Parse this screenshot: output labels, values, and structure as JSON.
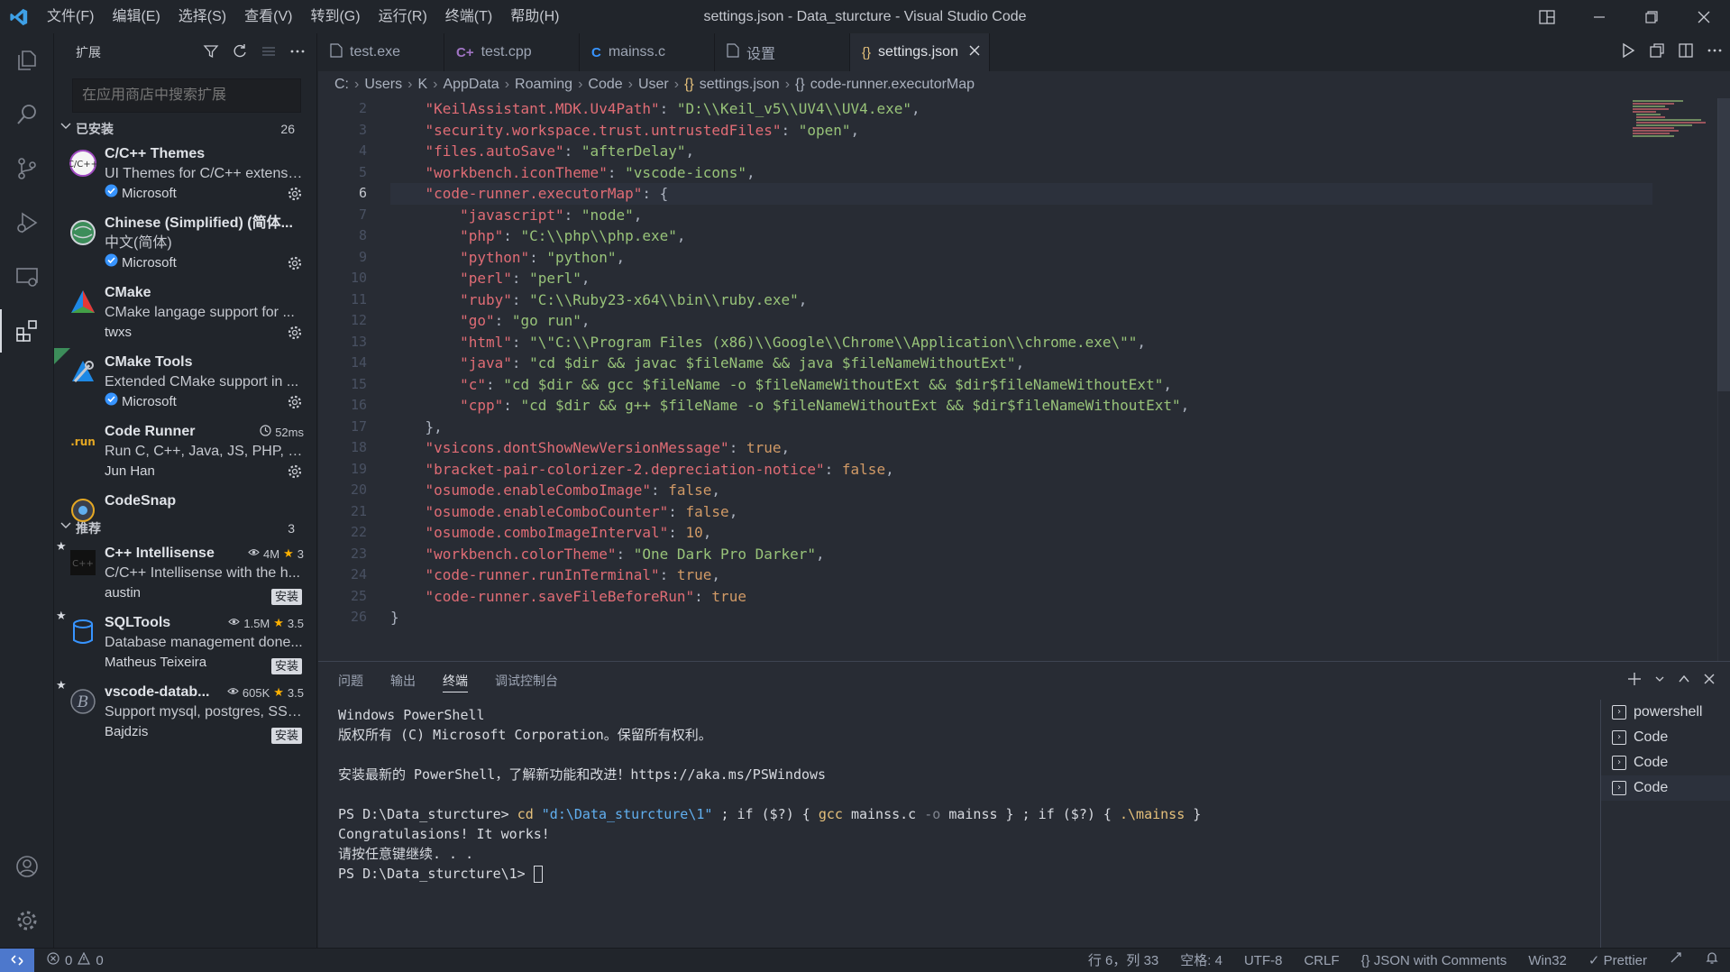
{
  "window": {
    "title": "settings.json - Data_sturcture - Visual Studio Code",
    "menu": [
      "文件(F)",
      "编辑(E)",
      "选择(S)",
      "查看(V)",
      "转到(G)",
      "运行(R)",
      "终端(T)",
      "帮助(H)"
    ]
  },
  "sidebar": {
    "title": "扩展",
    "search_placeholder": "在应用商店中搜索扩展",
    "installed": {
      "label": "已安装",
      "count": "26",
      "items": [
        {
          "name": "C/C++ Themes",
          "desc": "UI Themes for C/C++ extensi...",
          "publisher": "Microsoft",
          "icon": "cpp-themes-icon",
          "meta": ""
        },
        {
          "name": "Chinese (Simplified) (简体...",
          "desc": "中文(简体)",
          "publisher": "Microsoft",
          "icon": "globe-icon",
          "meta": ""
        },
        {
          "name": "CMake",
          "desc": "CMake langage support for ...",
          "publisher": "twxs",
          "icon": "cmake-icon",
          "meta": ""
        },
        {
          "name": "CMake Tools",
          "desc": "Extended CMake support in ...",
          "publisher": "Microsoft",
          "icon": "cmake-tools-icon",
          "meta": ""
        },
        {
          "name": "Code Runner",
          "desc": "Run C, C++, Java, JS, PHP, Py...",
          "publisher": "Jun Han",
          "icon": "run-icon",
          "meta": "52ms"
        },
        {
          "name": "CodeSnap",
          "desc": "",
          "publisher": "",
          "icon": "camera-icon",
          "meta": ""
        }
      ]
    },
    "recommended": {
      "label": "推荐",
      "count": "3",
      "items": [
        {
          "name": "C++ Intellisense",
          "desc": "C/C++ Intellisense with the h...",
          "publisher": "austin",
          "downloads": "4M",
          "rating": "3",
          "install": "安装"
        },
        {
          "name": "SQLTools",
          "desc": "Database management done...",
          "publisher": "Matheus Teixeira",
          "downloads": "1.5M",
          "rating": "3.5",
          "install": "安装"
        },
        {
          "name": "vscode-datab...",
          "desc": "Support mysql, postgres, SSL...",
          "publisher": "Bajdzis",
          "downloads": "605K",
          "rating": "3.5",
          "install": "安装"
        }
      ]
    }
  },
  "tabs": [
    {
      "label": "test.exe",
      "icon": "file-icon",
      "active": false
    },
    {
      "label": "test.cpp",
      "icon": "cpp-file-icon",
      "active": false
    },
    {
      "label": "mainss.c",
      "icon": "c-file-icon",
      "active": false
    },
    {
      "label": "设置",
      "icon": "settings-file-icon",
      "active": false
    },
    {
      "label": "settings.json",
      "icon": "json-icon",
      "active": true
    }
  ],
  "breadcrumb": [
    "C:",
    "Users",
    "K",
    "AppData",
    "Roaming",
    "Code",
    "User",
    "settings.json",
    "code-runner.executorMap"
  ],
  "editor": {
    "current_line": 6,
    "lines": [
      {
        "n": "2",
        "text": "    \"KeilAssistant.MDK.Uv4Path\": \"D:\\\\Keil_v5\\\\UV4\\\\UV4.exe\","
      },
      {
        "n": "3",
        "text": "    \"security.workspace.trust.untrustedFiles\": \"open\","
      },
      {
        "n": "4",
        "text": "    \"files.autoSave\": \"afterDelay\","
      },
      {
        "n": "5",
        "text": "    \"workbench.iconTheme\": \"vscode-icons\","
      },
      {
        "n": "6",
        "text": "    \"code-runner.executorMap\": {"
      },
      {
        "n": "7",
        "text": "        \"javascript\": \"node\","
      },
      {
        "n": "8",
        "text": "        \"php\": \"C:\\\\php\\\\php.exe\","
      },
      {
        "n": "9",
        "text": "        \"python\": \"python\","
      },
      {
        "n": "10",
        "text": "        \"perl\": \"perl\","
      },
      {
        "n": "11",
        "text": "        \"ruby\": \"C:\\\\Ruby23-x64\\\\bin\\\\ruby.exe\","
      },
      {
        "n": "12",
        "text": "        \"go\": \"go run\","
      },
      {
        "n": "13",
        "text": "        \"html\": \"\\\"C:\\\\Program Files (x86)\\\\Google\\\\Chrome\\\\Application\\\\chrome.exe\\\"\","
      },
      {
        "n": "14",
        "text": "        \"java\": \"cd $dir && javac $fileName && java $fileNameWithoutExt\","
      },
      {
        "n": "15",
        "text": "        \"c\": \"cd $dir && gcc $fileName -o $fileNameWithoutExt && $dir$fileNameWithoutExt\","
      },
      {
        "n": "16",
        "text": "        \"cpp\": \"cd $dir && g++ $fileName -o $fileNameWithoutExt && $dir$fileNameWithoutExt\","
      },
      {
        "n": "17",
        "text": "    },"
      },
      {
        "n": "18",
        "text": "    \"vsicons.dontShowNewVersionMessage\": true,"
      },
      {
        "n": "19",
        "text": "    \"bracket-pair-colorizer-2.depreciation-notice\": false,"
      },
      {
        "n": "20",
        "text": "    \"osumode.enableComboImage\": false,"
      },
      {
        "n": "21",
        "text": "    \"osumode.enableComboCounter\": false,"
      },
      {
        "n": "22",
        "text": "    \"osumode.comboImageInterval\": 10,"
      },
      {
        "n": "23",
        "text": "    \"workbench.colorTheme\": \"One Dark Pro Darker\","
      },
      {
        "n": "24",
        "text": "    \"code-runner.runInTerminal\": true,"
      },
      {
        "n": "25",
        "text": "    \"code-runner.saveFileBeforeRun\": true"
      },
      {
        "n": "26",
        "text": "}"
      }
    ]
  },
  "panel": {
    "tabs": [
      "问题",
      "输出",
      "终端",
      "调试控制台"
    ],
    "active_tab": "终端",
    "terminal_lines": [
      "Windows PowerShell",
      "版权所有 (C) Microsoft Corporation。保留所有权利。",
      "",
      "安装最新的 PowerShell，了解新功能和改进！https://aka.ms/PSWindows",
      "",
      "PS D:\\Data_sturcture> ",
      "Congratulasions! It works!",
      "请按任意键继续. . .",
      "PS D:\\Data_sturcture\\1> "
    ],
    "command": {
      "cd": "cd",
      "path": "\"d:\\Data_sturcture\\1\"",
      "rest1": " ; if ($?) { ",
      "gcc": "gcc",
      "args": " mainss.c ",
      "flag": "-o",
      "args2": " mainss } ; if ($?) { ",
      "exe": ".\\mainss",
      "end": " }"
    },
    "terminals": [
      "powershell",
      "Code",
      "Code",
      "Code"
    ]
  },
  "statusbar": {
    "errors": "0",
    "warnings": "0",
    "position": "行 6，列 33",
    "spaces": "空格: 4",
    "encoding": "UTF-8",
    "eol": "CRLF",
    "language": "JSON with Comments",
    "platform": "Win32",
    "formatter": "Prettier"
  },
  "colors": {
    "background": "#282c34",
    "sidebar": "#21252b",
    "key": "#e06c75",
    "string": "#98c379",
    "literal": "#d19a66",
    "accent": "#4d78cc"
  }
}
